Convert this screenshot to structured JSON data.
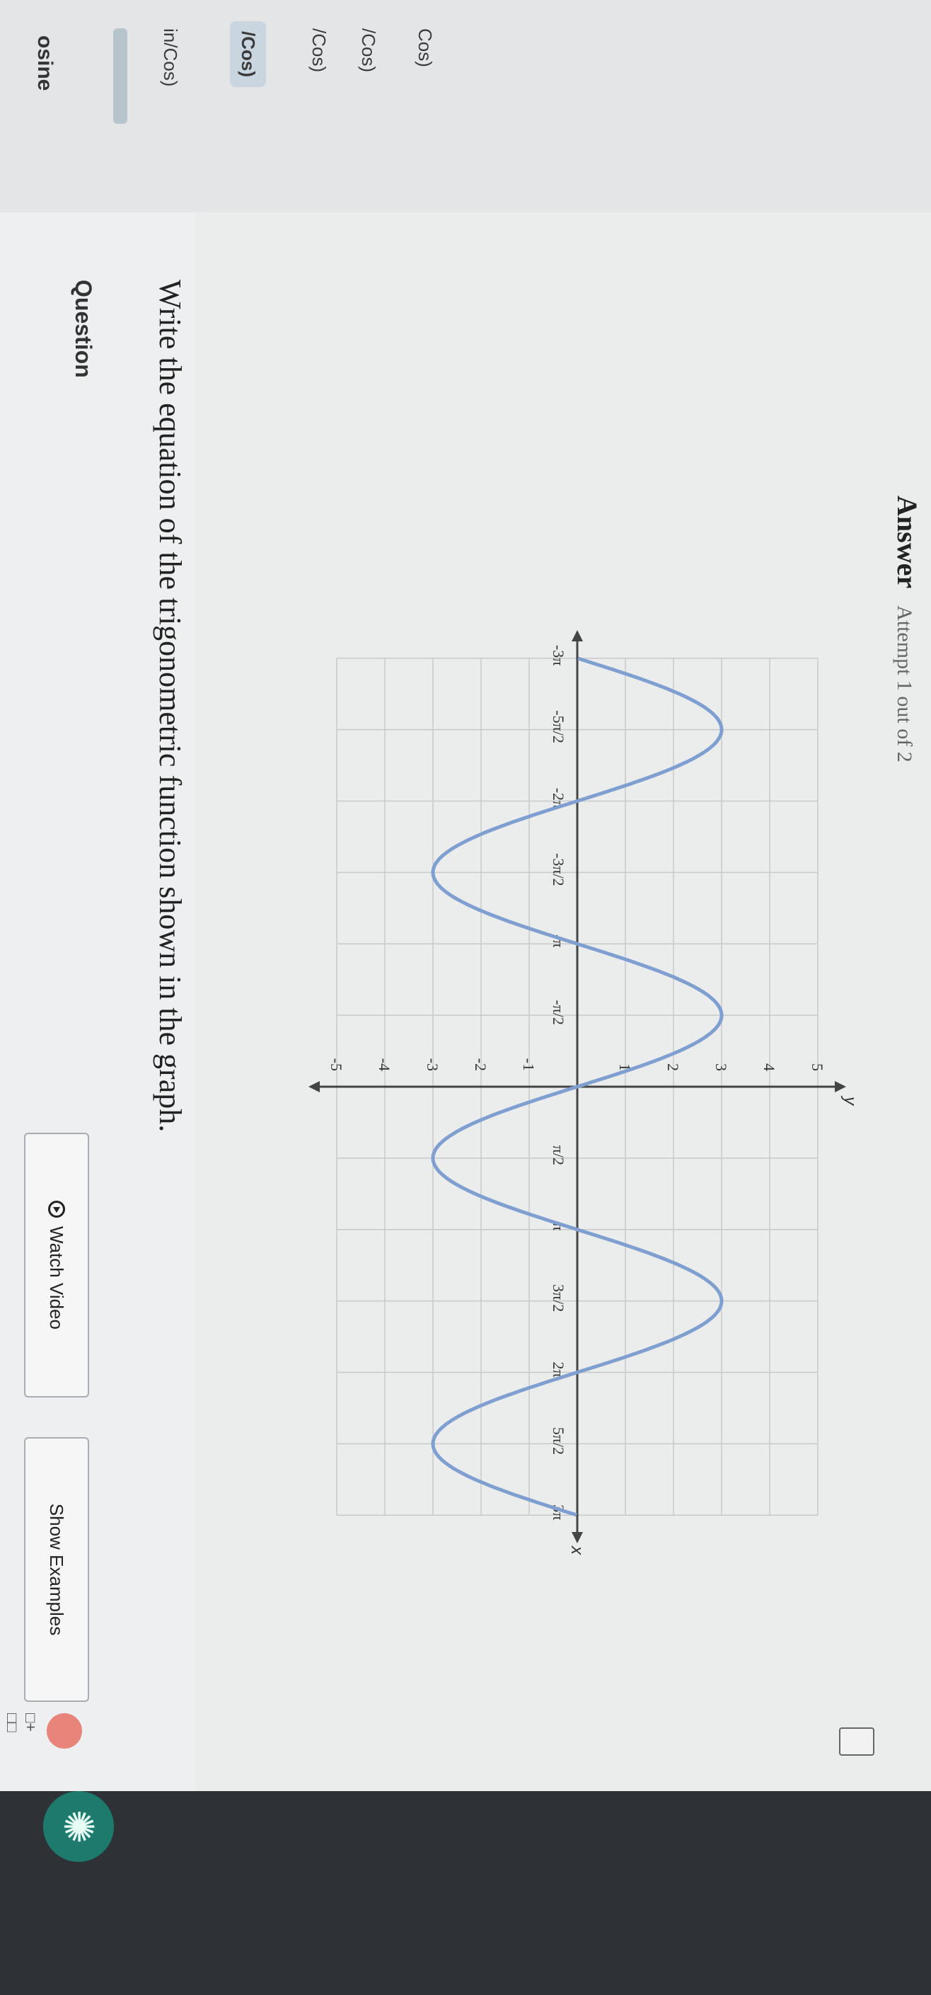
{
  "sidebar": {
    "title": "osine",
    "items": [
      {
        "label": "in/Cos)"
      },
      {
        "label": "/Cos)",
        "active": true
      },
      {
        "label": "/Cos)"
      },
      {
        "label": "/Cos)"
      },
      {
        "label": "Cos)"
      }
    ]
  },
  "question": {
    "label": "Question",
    "prompt": "Write the equation of the trigonometric function shown in the graph.",
    "watch_video_label": "Watch Video",
    "show_examples_label": "Show Examples"
  },
  "answer": {
    "label": "Answer",
    "attempt": "Attempt 1 out of 2"
  },
  "colors": {
    "curve": "#7f9fd0",
    "axis": "#444444",
    "grid": "#c8c9cb"
  },
  "icons": {
    "calculator": "calculator-icon",
    "help": "help-icon",
    "grid": "grid-icon",
    "assistant": "assistant-icon"
  },
  "chart_data": {
    "type": "line",
    "x_tick_labels": [
      "-3π",
      "-5π/2",
      "-2π",
      "-3π/2",
      "-π",
      "-π/2",
      "π/2",
      "π",
      "3π/2",
      "2π",
      "5π/2",
      "3π"
    ],
    "y_tick_labels": [
      "-5",
      "-4",
      "-3",
      "-2",
      "-1",
      "1",
      "2",
      "3",
      "4",
      "5"
    ],
    "xlabel": "x",
    "ylabel": "y",
    "xlim": [
      -9.42,
      9.42
    ],
    "ylim": [
      -5,
      5
    ],
    "grid": true,
    "series": [
      {
        "function_form": "y = -3 sin(x)",
        "amplitude": 3,
        "period": 6.283,
        "x_start": -9.42,
        "x_end": 9.42
      }
    ]
  }
}
